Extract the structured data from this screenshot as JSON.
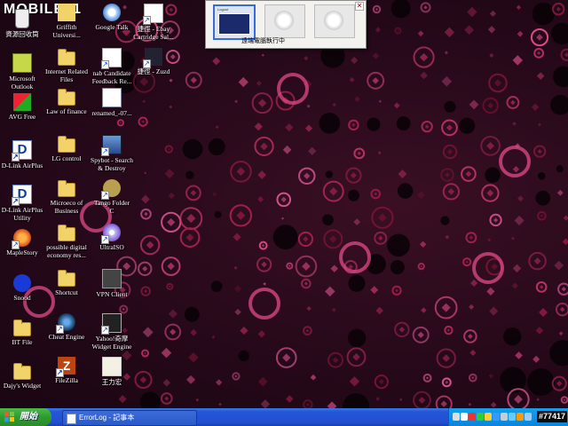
{
  "logo_text": "MOBILE01",
  "desktop_icons": [
    {
      "name": "recycle-bin",
      "icon": "recycle",
      "lines": [
        "資源回收筒"
      ]
    },
    {
      "name": "griffith",
      "icon": "griffith",
      "lines": [
        "Griffith",
        "Universi..."
      ]
    },
    {
      "name": "google-talk",
      "icon": "gtalk",
      "lines": [
        "Google Talk"
      ]
    },
    {
      "name": "ebay-shortcut",
      "icon": "ebay",
      "lines": [
        "捷徑 - Ebay",
        "Cartridge Sal..."
      ]
    },
    {
      "name": "microsoft-outlook",
      "icon": "outlook",
      "lines": [
        "Microsoft",
        "Outlook"
      ]
    },
    {
      "name": "internet-related-files",
      "icon": "folder",
      "lines": [
        "Internet Related",
        "Files"
      ]
    },
    {
      "name": "nab-candidate",
      "icon": "nab",
      "lines": [
        "nab Candidate",
        "Feedback Re..."
      ]
    },
    {
      "name": "zuzd-shortcut",
      "icon": "zuzd",
      "lines": [
        "捷徑 - Zuzd"
      ]
    },
    {
      "name": "avg-free",
      "icon": "avg",
      "lines": [
        "AVG Free"
      ]
    },
    {
      "name": "law-of-finance",
      "icon": "folder",
      "lines": [
        "Law of finance"
      ]
    },
    {
      "name": "renamed-file",
      "icon": "doc",
      "lines": [
        "renamed_-07..."
      ]
    },
    {
      "name": "dlink-airplus",
      "icon": "dlink",
      "lines": [
        "D-Link AirPlus"
      ]
    },
    {
      "name": "lg-control",
      "icon": "folder",
      "lines": [
        "LG control"
      ]
    },
    {
      "name": "spybot",
      "icon": "spy",
      "lines": [
        "Spybot - Search",
        "& Destroy"
      ]
    },
    {
      "name": "dlink-airplus-utility",
      "icon": "dlink",
      "lines": [
        "D-Link AirPlus",
        "Utility"
      ]
    },
    {
      "name": "microeco-of-business",
      "icon": "folder",
      "lines": [
        "Microeco of",
        "Business"
      ]
    },
    {
      "name": "tango-folder",
      "icon": "tango",
      "lines": [
        "Tango Folder",
        "C"
      ]
    },
    {
      "name": "maplestory",
      "icon": "maple",
      "lines": [
        "MapleStory"
      ]
    },
    {
      "name": "possible-digital-economy",
      "icon": "folder",
      "lines": [
        "possible digital",
        "economy res..."
      ]
    },
    {
      "name": "ultraiso",
      "icon": "uiso",
      "lines": [
        "UltraISO"
      ]
    },
    {
      "name": "snood",
      "icon": "snood",
      "lines": [
        "Snood"
      ]
    },
    {
      "name": "shortcut-folder",
      "icon": "folder",
      "lines": [
        "Shortcut"
      ]
    },
    {
      "name": "vpn-client",
      "icon": "vpn",
      "lines": [
        "VPN Client"
      ]
    },
    {
      "name": "bt-file",
      "icon": "folder",
      "lines": [
        "BT File"
      ]
    },
    {
      "name": "cheat-engine",
      "icon": "cheat",
      "lines": [
        "Cheat Engine"
      ]
    },
    {
      "name": "yahoo-widget-engine",
      "icon": "yahoo",
      "lines": [
        "Yahoo!奇摩",
        "Widget Engine"
      ]
    },
    {
      "name": "dajys-widget",
      "icon": "folder",
      "lines": [
        "Dajy's Widget"
      ]
    },
    {
      "name": "filezilla",
      "icon": "fz",
      "lines": [
        "FileZilla"
      ]
    },
    {
      "name": "wang-lihong",
      "icon": "wang",
      "lines": [
        "王力宏"
      ]
    }
  ],
  "popup": {
    "caption": "遠端電腦執行中",
    "thumb1_title": "Logout",
    "close_glyph": "✕"
  },
  "taskbar": {
    "start_label": "開始",
    "task_button_label": "ErrorLog - 記事本",
    "clock_text": "#77417"
  },
  "icons": {
    "start": "windows-flag-icon",
    "notepad": "notepad-icon",
    "tray": [
      "network-icon",
      "volume-icon",
      "security-icon",
      "update-icon",
      "shield-icon",
      "messenger-icon",
      "power-icon",
      "chat-icon",
      "antivirus-icon",
      "usb-icon"
    ]
  },
  "colors": {
    "taskbar": "#2456d8",
    "start_button": "#2e9a2e",
    "tray": "#0a84dc",
    "desktop_bg": "#26091a",
    "ring": "#c8356c"
  }
}
